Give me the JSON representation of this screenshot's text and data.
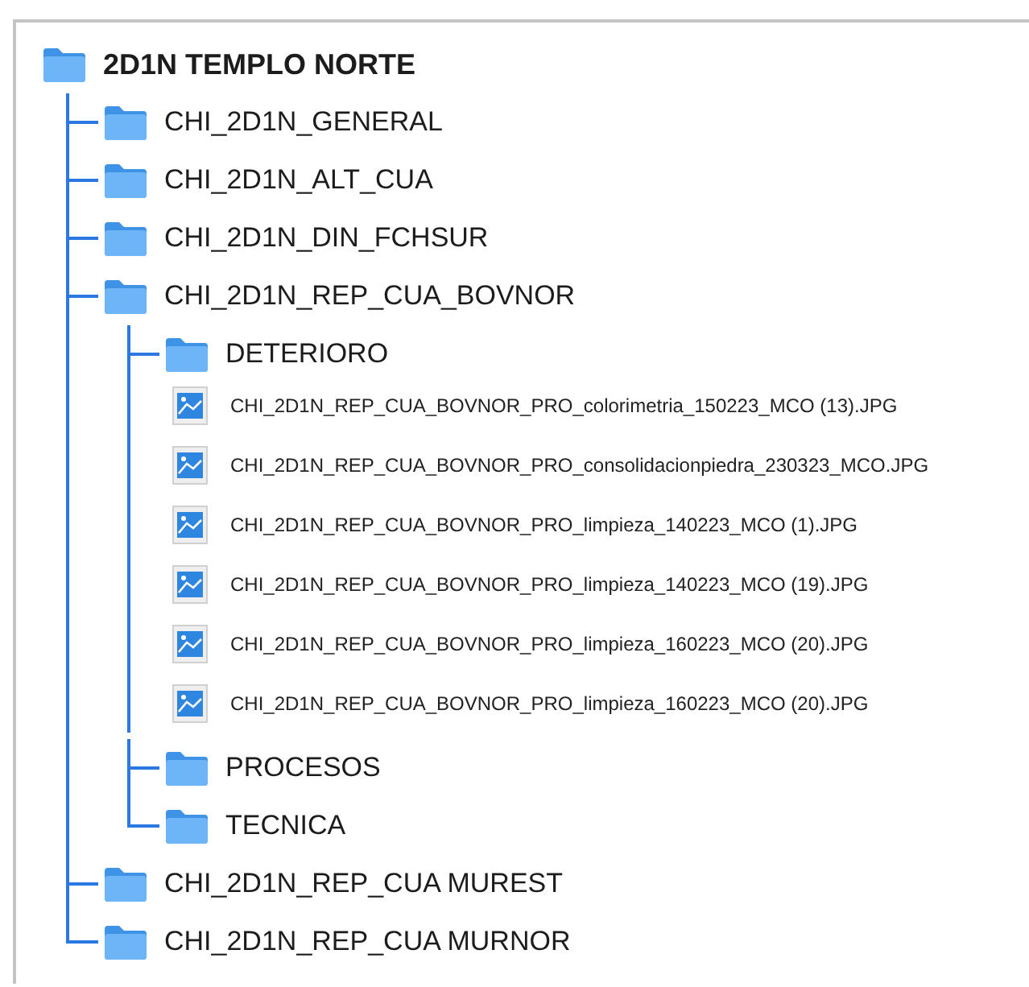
{
  "tree": {
    "name": "2D1N TEMPLO NORTE",
    "kind": "folder",
    "children": [
      {
        "name": "CHI_2D1N_GENERAL",
        "kind": "folder"
      },
      {
        "name": "CHI_2D1N_ALT_CUA",
        "kind": "folder"
      },
      {
        "name": "CHI_2D1N_DIN_FCHSUR",
        "kind": "folder"
      },
      {
        "name": "CHI_2D1N_REP_CUA_BOVNOR",
        "kind": "folder",
        "children": [
          {
            "name": "DETERIORO",
            "kind": "folder",
            "children": [
              {
                "name": "CHI_2D1N_REP_CUA_BOVNOR_PRO_colorimetria_150223_MCO (13).JPG",
                "kind": "image"
              },
              {
                "name": "CHI_2D1N_REP_CUA_BOVNOR_PRO_consolidacionpiedra_230323_MCO.JPG",
                "kind": "image"
              },
              {
                "name": "CHI_2D1N_REP_CUA_BOVNOR_PRO_limpieza_140223_MCO (1).JPG",
                "kind": "image"
              },
              {
                "name": "CHI_2D1N_REP_CUA_BOVNOR_PRO_limpieza_140223_MCO (19).JPG",
                "kind": "image"
              },
              {
                "name": "CHI_2D1N_REP_CUA_BOVNOR_PRO_limpieza_160223_MCO (20).JPG",
                "kind": "image"
              },
              {
                "name": "CHI_2D1N_REP_CUA_BOVNOR_PRO_limpieza_160223_MCO (20).JPG",
                "kind": "image"
              }
            ]
          },
          {
            "name": "PROCESOS",
            "kind": "folder"
          },
          {
            "name": "TECNICA",
            "kind": "folder"
          }
        ]
      },
      {
        "name": "CHI_2D1N_REP_CUA MUREST",
        "kind": "folder"
      },
      {
        "name": "CHI_2D1N_REP_CUA MURNOR",
        "kind": "folder"
      }
    ]
  }
}
